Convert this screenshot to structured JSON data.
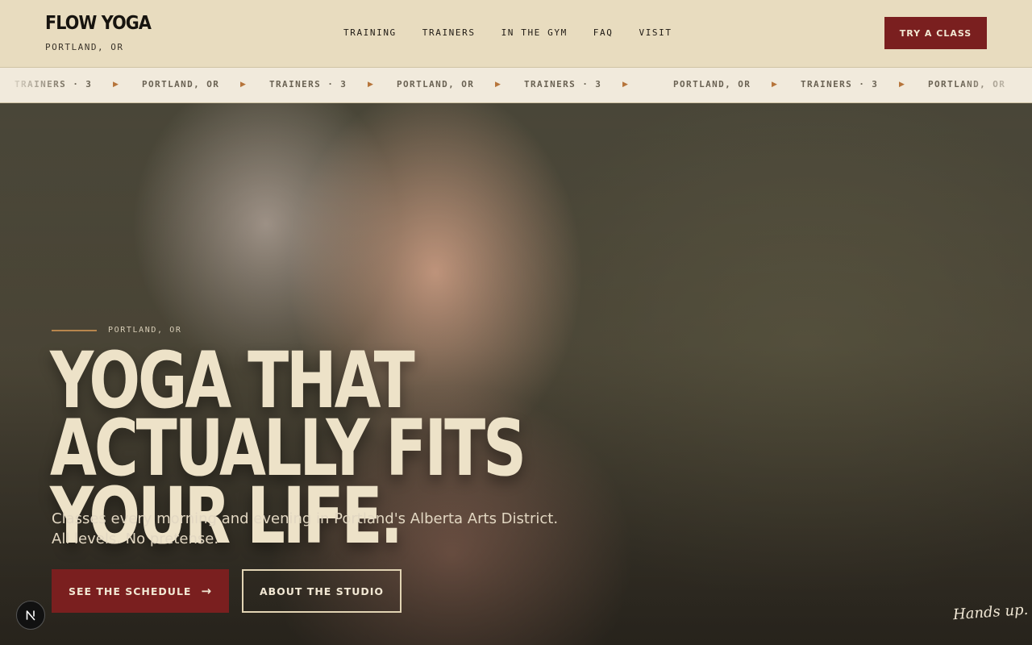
{
  "header": {
    "logo": {
      "title": "FLOW YOGA",
      "subtitle": "PORTLAND, OR"
    },
    "nav": [
      "TRAINING",
      "TRAINERS",
      "IN THE GYM",
      "FAQ",
      "VISIT"
    ],
    "cta_label": "TRY A CLASS"
  },
  "ticker": {
    "items": [
      "TRAINERS · 3",
      "PORTLAND, OR",
      "TRAINERS · 3",
      "PORTLAND, OR",
      "TRAINERS · 3",
      "PORTLAND, OR",
      "TRAINERS · 3",
      "PORTLAND, OR"
    ],
    "separator_icon": "triangle-right-icon",
    "separator_color": "#b6743a"
  },
  "hero": {
    "eyebrow": "PORTLAND, OR",
    "headline": [
      "YOGA THAT ACTUALLY FITS",
      "YOUR LIFE."
    ],
    "subcopy": [
      "Classes every morning and evening in Portland's Alberta Arts District.",
      "All levels. No pretense."
    ],
    "primary_button": {
      "label": "SEE THE SCHEDULE",
      "arrow": "→"
    },
    "secondary_button": {
      "label": "ABOUT THE STUDIO"
    },
    "script_text": "Hands up."
  },
  "colors": {
    "header_bg": "#e8dcbf",
    "accent": "#7a1f1f",
    "ticker_bg": "#f1eadc",
    "headline": "#ede2c8"
  }
}
